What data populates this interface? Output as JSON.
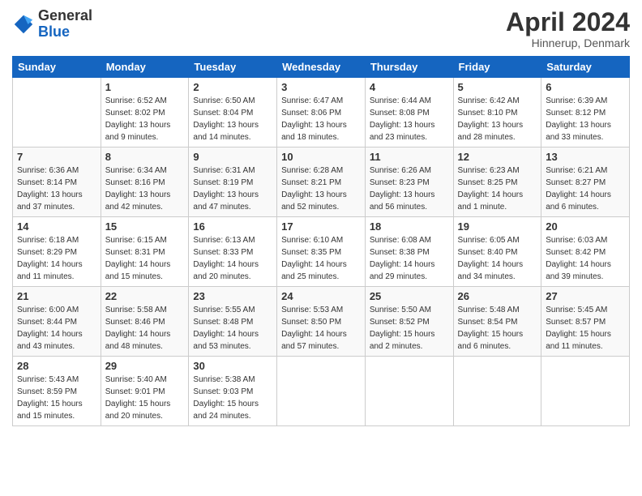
{
  "header": {
    "logo": {
      "line1": "General",
      "line2": "Blue"
    },
    "title": "April 2024",
    "subtitle": "Hinnerup, Denmark"
  },
  "calendar": {
    "headers": [
      "Sunday",
      "Monday",
      "Tuesday",
      "Wednesday",
      "Thursday",
      "Friday",
      "Saturday"
    ],
    "weeks": [
      [
        {
          "day": "",
          "sunrise": "",
          "sunset": "",
          "daylight": ""
        },
        {
          "day": "1",
          "sunrise": "Sunrise: 6:52 AM",
          "sunset": "Sunset: 8:02 PM",
          "daylight": "Daylight: 13 hours and 9 minutes."
        },
        {
          "day": "2",
          "sunrise": "Sunrise: 6:50 AM",
          "sunset": "Sunset: 8:04 PM",
          "daylight": "Daylight: 13 hours and 14 minutes."
        },
        {
          "day": "3",
          "sunrise": "Sunrise: 6:47 AM",
          "sunset": "Sunset: 8:06 PM",
          "daylight": "Daylight: 13 hours and 18 minutes."
        },
        {
          "day": "4",
          "sunrise": "Sunrise: 6:44 AM",
          "sunset": "Sunset: 8:08 PM",
          "daylight": "Daylight: 13 hours and 23 minutes."
        },
        {
          "day": "5",
          "sunrise": "Sunrise: 6:42 AM",
          "sunset": "Sunset: 8:10 PM",
          "daylight": "Daylight: 13 hours and 28 minutes."
        },
        {
          "day": "6",
          "sunrise": "Sunrise: 6:39 AM",
          "sunset": "Sunset: 8:12 PM",
          "daylight": "Daylight: 13 hours and 33 minutes."
        }
      ],
      [
        {
          "day": "7",
          "sunrise": "Sunrise: 6:36 AM",
          "sunset": "Sunset: 8:14 PM",
          "daylight": "Daylight: 13 hours and 37 minutes."
        },
        {
          "day": "8",
          "sunrise": "Sunrise: 6:34 AM",
          "sunset": "Sunset: 8:16 PM",
          "daylight": "Daylight: 13 hours and 42 minutes."
        },
        {
          "day": "9",
          "sunrise": "Sunrise: 6:31 AM",
          "sunset": "Sunset: 8:19 PM",
          "daylight": "Daylight: 13 hours and 47 minutes."
        },
        {
          "day": "10",
          "sunrise": "Sunrise: 6:28 AM",
          "sunset": "Sunset: 8:21 PM",
          "daylight": "Daylight: 13 hours and 52 minutes."
        },
        {
          "day": "11",
          "sunrise": "Sunrise: 6:26 AM",
          "sunset": "Sunset: 8:23 PM",
          "daylight": "Daylight: 13 hours and 56 minutes."
        },
        {
          "day": "12",
          "sunrise": "Sunrise: 6:23 AM",
          "sunset": "Sunset: 8:25 PM",
          "daylight": "Daylight: 14 hours and 1 minute."
        },
        {
          "day": "13",
          "sunrise": "Sunrise: 6:21 AM",
          "sunset": "Sunset: 8:27 PM",
          "daylight": "Daylight: 14 hours and 6 minutes."
        }
      ],
      [
        {
          "day": "14",
          "sunrise": "Sunrise: 6:18 AM",
          "sunset": "Sunset: 8:29 PM",
          "daylight": "Daylight: 14 hours and 11 minutes."
        },
        {
          "day": "15",
          "sunrise": "Sunrise: 6:15 AM",
          "sunset": "Sunset: 8:31 PM",
          "daylight": "Daylight: 14 hours and 15 minutes."
        },
        {
          "day": "16",
          "sunrise": "Sunrise: 6:13 AM",
          "sunset": "Sunset: 8:33 PM",
          "daylight": "Daylight: 14 hours and 20 minutes."
        },
        {
          "day": "17",
          "sunrise": "Sunrise: 6:10 AM",
          "sunset": "Sunset: 8:35 PM",
          "daylight": "Daylight: 14 hours and 25 minutes."
        },
        {
          "day": "18",
          "sunrise": "Sunrise: 6:08 AM",
          "sunset": "Sunset: 8:38 PM",
          "daylight": "Daylight: 14 hours and 29 minutes."
        },
        {
          "day": "19",
          "sunrise": "Sunrise: 6:05 AM",
          "sunset": "Sunset: 8:40 PM",
          "daylight": "Daylight: 14 hours and 34 minutes."
        },
        {
          "day": "20",
          "sunrise": "Sunrise: 6:03 AM",
          "sunset": "Sunset: 8:42 PM",
          "daylight": "Daylight: 14 hours and 39 minutes."
        }
      ],
      [
        {
          "day": "21",
          "sunrise": "Sunrise: 6:00 AM",
          "sunset": "Sunset: 8:44 PM",
          "daylight": "Daylight: 14 hours and 43 minutes."
        },
        {
          "day": "22",
          "sunrise": "Sunrise: 5:58 AM",
          "sunset": "Sunset: 8:46 PM",
          "daylight": "Daylight: 14 hours and 48 minutes."
        },
        {
          "day": "23",
          "sunrise": "Sunrise: 5:55 AM",
          "sunset": "Sunset: 8:48 PM",
          "daylight": "Daylight: 14 hours and 53 minutes."
        },
        {
          "day": "24",
          "sunrise": "Sunrise: 5:53 AM",
          "sunset": "Sunset: 8:50 PM",
          "daylight": "Daylight: 14 hours and 57 minutes."
        },
        {
          "day": "25",
          "sunrise": "Sunrise: 5:50 AM",
          "sunset": "Sunset: 8:52 PM",
          "daylight": "Daylight: 15 hours and 2 minutes."
        },
        {
          "day": "26",
          "sunrise": "Sunrise: 5:48 AM",
          "sunset": "Sunset: 8:54 PM",
          "daylight": "Daylight: 15 hours and 6 minutes."
        },
        {
          "day": "27",
          "sunrise": "Sunrise: 5:45 AM",
          "sunset": "Sunset: 8:57 PM",
          "daylight": "Daylight: 15 hours and 11 minutes."
        }
      ],
      [
        {
          "day": "28",
          "sunrise": "Sunrise: 5:43 AM",
          "sunset": "Sunset: 8:59 PM",
          "daylight": "Daylight: 15 hours and 15 minutes."
        },
        {
          "day": "29",
          "sunrise": "Sunrise: 5:40 AM",
          "sunset": "Sunset: 9:01 PM",
          "daylight": "Daylight: 15 hours and 20 minutes."
        },
        {
          "day": "30",
          "sunrise": "Sunrise: 5:38 AM",
          "sunset": "Sunset: 9:03 PM",
          "daylight": "Daylight: 15 hours and 24 minutes."
        },
        {
          "day": "",
          "sunrise": "",
          "sunset": "",
          "daylight": ""
        },
        {
          "day": "",
          "sunrise": "",
          "sunset": "",
          "daylight": ""
        },
        {
          "day": "",
          "sunrise": "",
          "sunset": "",
          "daylight": ""
        },
        {
          "day": "",
          "sunrise": "",
          "sunset": "",
          "daylight": ""
        }
      ]
    ]
  }
}
